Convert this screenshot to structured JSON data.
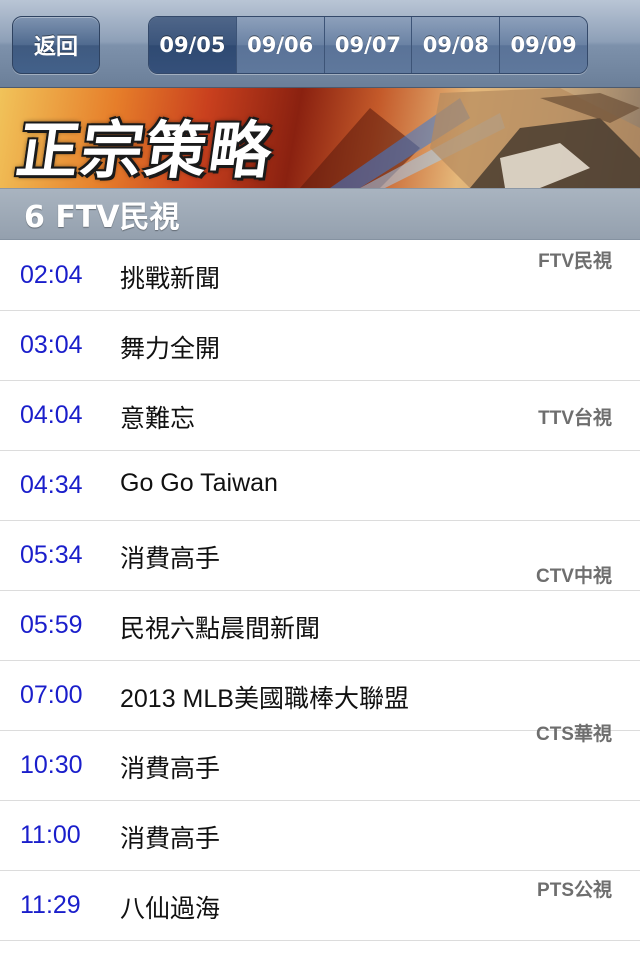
{
  "navbar": {
    "back_label": "返回",
    "dates": [
      {
        "label": "09/05",
        "selected": true
      },
      {
        "label": "09/06",
        "selected": false
      },
      {
        "label": "09/07",
        "selected": false
      },
      {
        "label": "09/08",
        "selected": false
      },
      {
        "label": "09/09",
        "selected": false
      }
    ]
  },
  "banner": {
    "title": "正宗策略"
  },
  "section": {
    "title": "6 FTV民視"
  },
  "programs": [
    {
      "time": "02:04",
      "title": "挑戰新聞"
    },
    {
      "time": "03:04",
      "title": "舞力全開"
    },
    {
      "time": "04:04",
      "title": "意難忘"
    },
    {
      "time": "04:34",
      "title": "Go Go Taiwan"
    },
    {
      "time": "05:34",
      "title": "消費高手"
    },
    {
      "time": "05:59",
      "title": "民視六點晨間新聞"
    },
    {
      "time": "07:00",
      "title": "2013 MLB美國職棒大聯盟"
    },
    {
      "time": "10:30",
      "title": "消費高手"
    },
    {
      "time": "11:00",
      "title": "消費高手"
    },
    {
      "time": "11:29",
      "title": "八仙過海"
    }
  ],
  "channel_index": [
    "FTV民視",
    "TTV台視",
    "CTV中視",
    "CTS華視",
    "PTS公視"
  ],
  "colors": {
    "time_text": "#1a1ecb",
    "index_text": "#6e6e6e",
    "nav_bar": "#8d9fb7"
  }
}
